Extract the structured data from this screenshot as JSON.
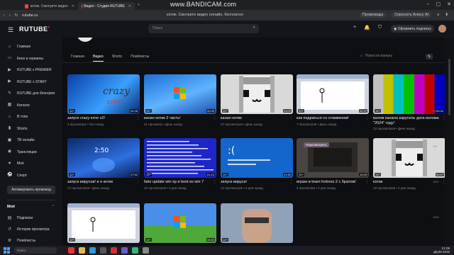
{
  "browser": {
    "tabs": [
      {
        "label": "котик. Смотрите видео",
        "active": false
      },
      {
        "label": "Видео - Студия RUTUBE",
        "active": true
      }
    ],
    "watermark": "www.BANDICAM.com",
    "url": "rutube.ru",
    "page_title": "котик. Смотрите видео онлайн, бесплатно",
    "promo_label": "Промокоды",
    "ask_label": "Спросить Алису AI"
  },
  "header": {
    "logo": "RUTUBE",
    "search_placeholder": "Поиск",
    "subscribe_label": "Оформить подписку"
  },
  "sidebar": {
    "items": [
      {
        "label": "Главная",
        "icon": "home-icon"
      },
      {
        "label": "Кино и сериалы",
        "icon": "film-icon"
      },
      {
        "label": "RUTUBE x PREMIER",
        "icon": "premier-icon"
      },
      {
        "label": "RUTUBE x START",
        "icon": "start-icon"
      },
      {
        "label": "RUTUBE для блогеров",
        "icon": "blogger-icon"
      },
      {
        "label": "Каталог",
        "icon": "catalog-icon"
      },
      {
        "label": "В топе",
        "icon": "fire-icon"
      },
      {
        "label": "Shorts",
        "icon": "shorts-icon"
      },
      {
        "label": "ТВ онлайн",
        "icon": "tv-icon"
      },
      {
        "label": "Трансляции",
        "icon": "broadcast-icon"
      },
      {
        "label": "Моё",
        "icon": "my-icon"
      },
      {
        "label": "Спорт",
        "icon": "sport-icon"
      }
    ],
    "activate_label": "Активировать промокод",
    "my_section": "Моё",
    "my_items": [
      {
        "label": "Подписки",
        "icon": "subscriptions-icon"
      },
      {
        "label": "История просмотра",
        "icon": "history-icon"
      },
      {
        "label": "Плейлисты",
        "icon": "playlists-icon"
      }
    ]
  },
  "channel": {
    "tabs": [
      {
        "label": "Главная",
        "active": false
      },
      {
        "label": "Видео",
        "active": true
      },
      {
        "label": "Shorts",
        "active": false
      },
      {
        "label": "Плейлисты",
        "active": false
      }
    ],
    "search_placeholder": "Поиск по каналу"
  },
  "videos": [
    {
      "title": "запуск crazy error v2!",
      "views": "4 просмотра",
      "time": "Час назад",
      "age": "12+",
      "duration": "02:28",
      "thumb": "crazy"
    },
    {
      "title": "канал котик 2 часть!",
      "views": "41 просмотр",
      "time": "День назад",
      "age": "12+",
      "duration": "00:30",
      "thumb": "win7"
    },
    {
      "title": "канал котик",
      "views": "27 просмотров",
      "time": "День назад",
      "age": "12+",
      "duration": "03:09",
      "thumb": "cat"
    },
    {
      "title": "как подраться со стикменом!",
      "views": "7 просмотров",
      "time": "День назад",
      "age": "12+",
      "duration": "02:37",
      "thumb": "paint"
    },
    {
      "title": "взлом канала карусель дата взлома \"2024\" году!",
      "views": "12 просмотров",
      "time": "День назад",
      "age": "12+",
      "duration": "00:20",
      "thumb": "bars"
    },
    {
      "title": "запуск вирусов! и я котик",
      "views": "17 просмотров",
      "time": "День назад",
      "age": "12+",
      "duration": "07:52",
      "thumb": "win11"
    },
    {
      "title": "fake update win xp и boot из win 7",
      "views": "12 просмотров",
      "time": "2 дня назад",
      "age": "12+",
      "duration": "01:24",
      "thumb": "bsod"
    },
    {
      "title": "запуск вируса!",
      "views": "14 просмотров",
      "time": "2 дня назад",
      "age": "12+",
      "duration": "01:50",
      "thumb": "bsodface"
    },
    {
      "title": "играю в team fortress 2 с братом!",
      "views": "4 просмотра",
      "time": "2 дня назад",
      "age": "12+",
      "duration": "10:00",
      "thumb": "tf2",
      "overlay": "Пересмотреть"
    },
    {
      "title": "котик",
      "views": "12 просмотров",
      "time": "2 дня назад",
      "age": "12+",
      "duration": "00:07",
      "thumb": "cat"
    },
    {
      "title": "",
      "views": "",
      "time": "",
      "age": "12+",
      "duration": "",
      "thumb": "paint"
    },
    {
      "title": "",
      "views": "",
      "time": "",
      "age": "12+",
      "duration": "05:53",
      "thumb": "xpcat"
    },
    {
      "title": "",
      "views": "",
      "time": "",
      "age": "12+",
      "duration": "",
      "thumb": "face"
    }
  ],
  "scale_labels": [
    "10:00",
    "100",
    "1000",
    "1200",
    "1500"
  ],
  "taskbar": {
    "search_placeholder": "Поиск",
    "time": "21:09",
    "date": "20.08.2025"
  }
}
